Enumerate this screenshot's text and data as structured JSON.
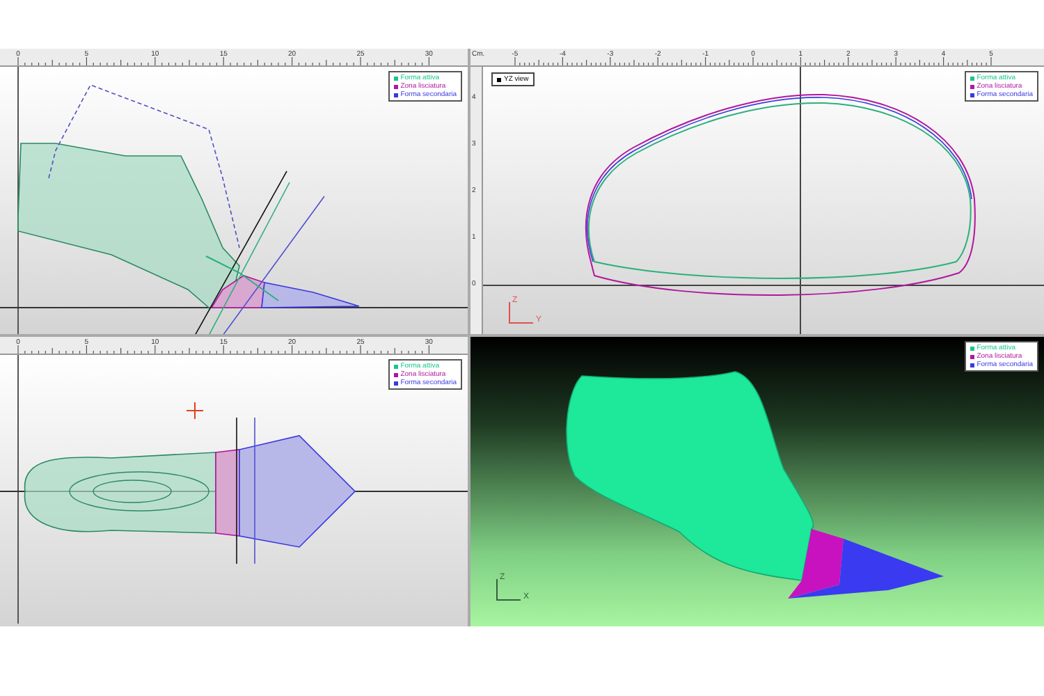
{
  "viewports": [
    {
      "kind": "side",
      "ruler": {
        "labels": [
          "0",
          "5",
          "10",
          "15",
          "20",
          "25",
          "30"
        ]
      },
      "legend": [
        {
          "label": "Forma attiva",
          "color": "#17c784"
        },
        {
          "label": "Zona lisciatura",
          "color": "#b0179c"
        },
        {
          "label": "Forma secondaria",
          "color": "#3a3ae0"
        }
      ]
    },
    {
      "kind": "front",
      "view_label": "YZ view",
      "axes": [
        "Z",
        "Y"
      ],
      "ruler": {
        "unit": "Cm.",
        "labels": [
          "-5",
          "-4",
          "-3",
          "-2",
          "-1",
          "0",
          "1",
          "2",
          "3",
          "4",
          "5"
        ]
      },
      "vruler": [
        "4",
        "3",
        "2",
        "1",
        "0"
      ],
      "legend": [
        {
          "label": "Forma attiva",
          "color": "#17c784"
        },
        {
          "label": "Zona lisciatura",
          "color": "#b0179c"
        },
        {
          "label": "Forma secondaria",
          "color": "#3a3ae0"
        }
      ]
    },
    {
      "kind": "top",
      "ruler": {
        "labels": [
          "0",
          "5",
          "10",
          "15",
          "20",
          "25",
          "30"
        ]
      },
      "legend": [
        {
          "label": "Forma attiva",
          "color": "#17c784"
        },
        {
          "label": "Zona lisciatura",
          "color": "#b0179c"
        },
        {
          "label": "Forma secondaria",
          "color": "#3a3ae0"
        }
      ]
    },
    {
      "kind": "render",
      "axes": [
        "Z",
        "X"
      ],
      "legend": [
        {
          "label": "Forma attiva",
          "color": "#17c784"
        },
        {
          "label": "Zona lisciatura",
          "color": "#b0179c"
        },
        {
          "label": "Forma secondaria",
          "color": "#3a3ae0"
        }
      ]
    }
  ]
}
